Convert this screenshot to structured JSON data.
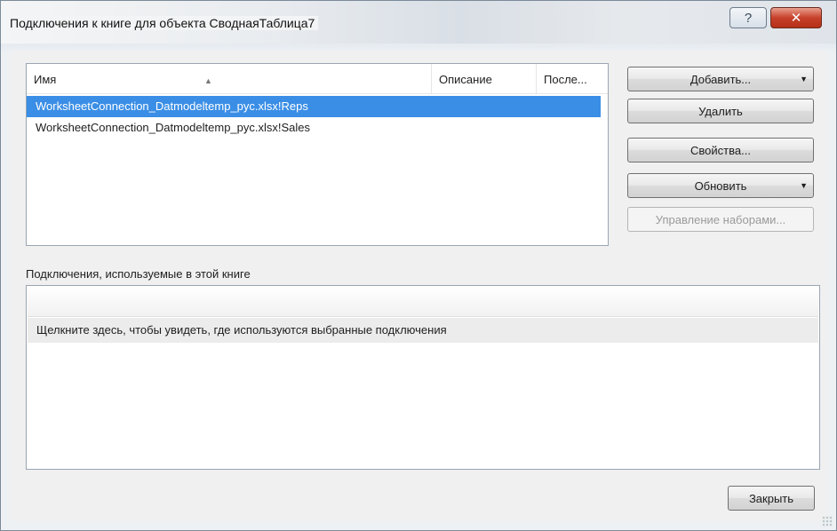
{
  "window": {
    "title": "Подключения к книге для объекта СводнаяТаблица7",
    "help_glyph": "?",
    "close_glyph": "✕"
  },
  "connections_list": {
    "columns": [
      "Имя",
      "Описание",
      "После..."
    ],
    "sort_glyph": "▲",
    "rows": [
      {
        "name": "WorksheetConnection_Datmodeltemp_pyc.xlsx!Reps",
        "selected": true
      },
      {
        "name": "WorksheetConnection_Datmodeltemp_pyc.xlsx!Sales",
        "selected": false
      }
    ]
  },
  "actions": {
    "add": "Добавить...",
    "remove": "Удалить",
    "properties": "Свойства...",
    "refresh": "Обновить",
    "manage_sets": "Управление наборами...",
    "caret_glyph": "▼"
  },
  "usage": {
    "label": "Подключения, используемые в этой книге",
    "hint": "Щелкните здесь, чтобы увидеть, где используются выбранные подключения"
  },
  "footer": {
    "close": "Закрыть"
  },
  "colors": {
    "selection": "#3a8ee6",
    "close_button": "#c7412a"
  }
}
